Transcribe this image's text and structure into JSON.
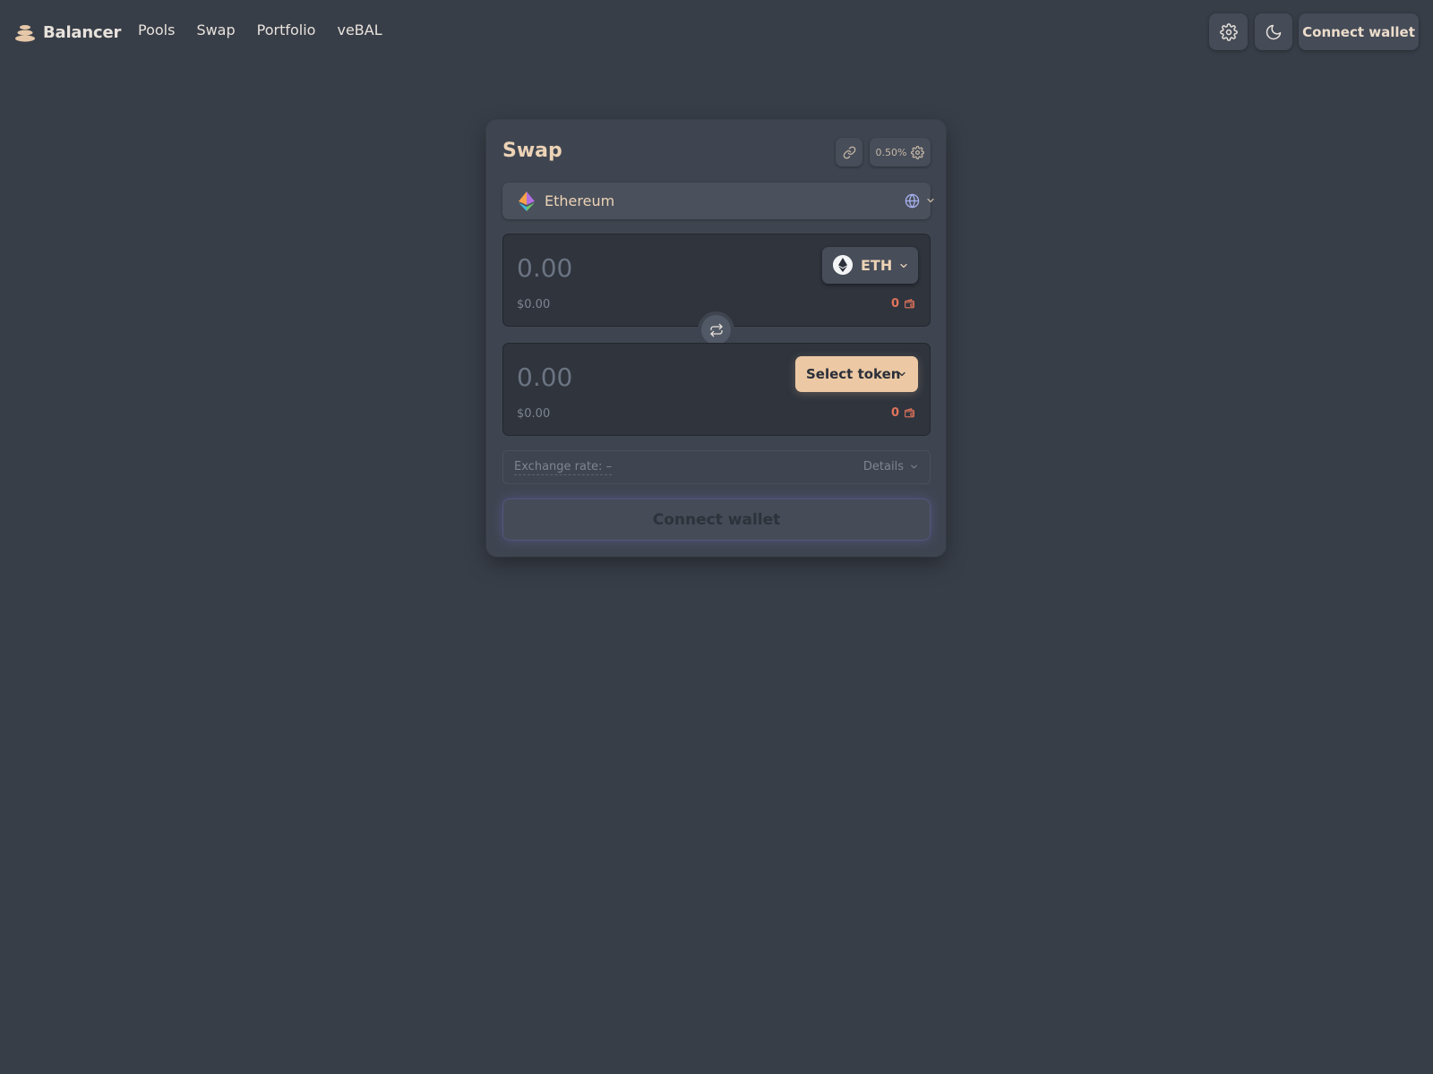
{
  "brand": {
    "name": "Balancer"
  },
  "nav": [
    {
      "label": "Pools"
    },
    {
      "label": "Swap"
    },
    {
      "label": "Portfolio"
    },
    {
      "label": "veBAL"
    }
  ],
  "header": {
    "connect_label": "Connect wallet",
    "settings_icon": "gear-icon",
    "theme_icon": "moon-icon"
  },
  "swap": {
    "title": "Swap",
    "slippage": "0.50%",
    "network": {
      "name": "Ethereum"
    },
    "token_in": {
      "placeholder": "0.00",
      "usd": "$0.00",
      "symbol": "ETH",
      "balance": "0"
    },
    "token_out": {
      "placeholder": "0.00",
      "usd": "$0.00",
      "select_label": "Select token",
      "balance": "0"
    },
    "exchange_rate": "Exchange rate: –",
    "details_label": "Details",
    "connect_label": "Connect wallet"
  },
  "colors": {
    "background": "#383e48",
    "card": "#3f4550",
    "accent": "#ecc9a4",
    "balance": "#e2735c",
    "text": "#ecd3b6"
  }
}
